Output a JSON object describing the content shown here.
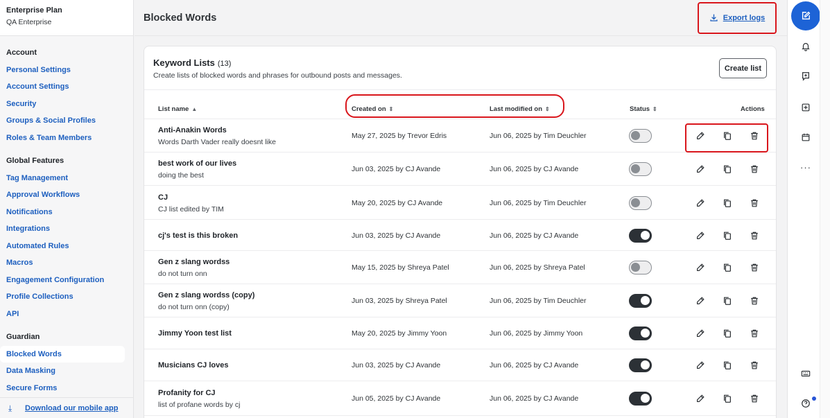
{
  "org": {
    "plan": "Enterprise Plan",
    "name": "QA Enterprise"
  },
  "sidebar": {
    "sections": [
      {
        "title": "Account",
        "items": [
          "Personal Settings",
          "Account Settings",
          "Security",
          "Groups & Social Profiles",
          "Roles & Team Members"
        ]
      },
      {
        "title": "Global Features",
        "items": [
          "Tag Management",
          "Approval Workflows",
          "Notifications",
          "Integrations",
          "Automated Rules",
          "Macros",
          "Engagement Configuration",
          "Profile Collections",
          "API"
        ]
      },
      {
        "title": "Guardian",
        "items": [
          "Blocked Words",
          "Data Masking",
          "Secure Forms"
        ]
      }
    ],
    "active_item": "Blocked Words",
    "mobile_link": "Download our mobile app"
  },
  "header": {
    "title": "Blocked Words",
    "export_label": "Export logs"
  },
  "card": {
    "title": "Keyword Lists",
    "count": "(13)",
    "description": "Create lists of blocked words and phrases for outbound posts and messages.",
    "create_label": "Create list"
  },
  "table": {
    "columns": {
      "name": "List name",
      "created": "Created on",
      "modified": "Last modified on",
      "status": "Status",
      "actions": "Actions"
    },
    "rows": [
      {
        "name": "Anti-Anakin Words",
        "desc": "Words Darth Vader really doesnt like",
        "created": "May 27, 2025 by Trevor Edris",
        "modified": "Jun 06, 2025 by Tim Deuchler",
        "enabled": false
      },
      {
        "name": "best work of our lives",
        "desc": "doing the best",
        "created": "Jun 03, 2025 by CJ Avande",
        "modified": "Jun 06, 2025 by CJ Avande",
        "enabled": false
      },
      {
        "name": "CJ",
        "desc": "CJ list edited by TIM",
        "created": "May 20, 2025 by CJ Avande",
        "modified": "Jun 06, 2025 by Tim Deuchler",
        "enabled": false
      },
      {
        "name": "cj's test is this broken",
        "desc": "",
        "created": "Jun 03, 2025 by CJ Avande",
        "modified": "Jun 06, 2025 by CJ Avande",
        "enabled": true
      },
      {
        "name": "Gen z slang wordss",
        "desc": "do not turn onn",
        "created": "May 15, 2025 by Shreya Patel",
        "modified": "Jun 06, 2025 by Shreya Patel",
        "enabled": false
      },
      {
        "name": "Gen z slang wordss (copy)",
        "desc": "do not turn onn (copy)",
        "created": "Jun 03, 2025 by Shreya Patel",
        "modified": "Jun 06, 2025 by Tim Deuchler",
        "enabled": true
      },
      {
        "name": "Jimmy Yoon test list",
        "desc": "",
        "created": "May 20, 2025 by Jimmy Yoon",
        "modified": "Jun 06, 2025 by Jimmy Yoon",
        "enabled": true
      },
      {
        "name": "Musicians CJ loves",
        "desc": "",
        "created": "Jun 03, 2025 by CJ Avande",
        "modified": "Jun 06, 2025 by CJ Avande",
        "enabled": true
      },
      {
        "name": "Profanity for CJ",
        "desc": "list of profane words by cj",
        "created": "Jun 05, 2025 by CJ Avande",
        "modified": "Jun 06, 2025 by CJ Avande",
        "enabled": true
      }
    ]
  },
  "colors": {
    "link": "#1d5fbf",
    "highlight": "#d9161c",
    "compose": "#1d63d6",
    "toggle_on": "#2c3136"
  },
  "icons": [
    "download-icon",
    "sort-icon",
    "edit-icon",
    "copy-icon",
    "delete-icon",
    "compose-icon",
    "bell-icon",
    "chat-plus-icon",
    "add-square-icon",
    "calendar-icon",
    "more-icon",
    "keyboard-icon",
    "help-icon"
  ]
}
